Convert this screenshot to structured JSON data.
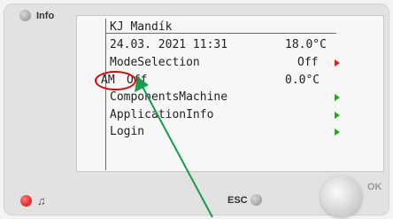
{
  "panel": {
    "info_label": "Info",
    "esc_label": "ESC",
    "ok_label": "OK"
  },
  "screen": {
    "title": "KJ Mandík",
    "datetime": "24.03. 2021 11:31",
    "temp_top": "18.0°C",
    "mode_label": "ModeSelection",
    "mode_value": "Off",
    "am_label": "AM",
    "am_value": "Off",
    "am_temp": "0.0°C",
    "menu": [
      {
        "label": "ComponentsMachine"
      },
      {
        "label": "ApplicationInfo"
      },
      {
        "label": "Login"
      }
    ]
  },
  "annotation": {
    "circle_color": "#e00000",
    "arrow_color": "#1a9a4a"
  }
}
